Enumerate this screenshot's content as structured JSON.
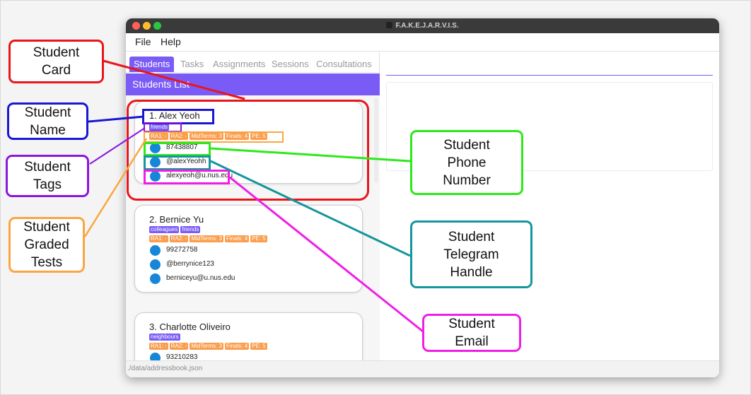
{
  "window": {
    "title": "F.A.K.E.J.A.R.V.I.S."
  },
  "menu": [
    "File",
    "Help"
  ],
  "tabs": [
    {
      "label": "Students",
      "active": true
    },
    {
      "label": "Tasks",
      "active": false
    },
    {
      "label": "Assignments",
      "active": false
    },
    {
      "label": "Sessions",
      "active": false
    },
    {
      "label": "Consultations",
      "active": false
    }
  ],
  "list": {
    "title": "Students List"
  },
  "students": [
    {
      "name": "1.  Alex Yeoh",
      "tags": [
        "friends"
      ],
      "grades": [
        "RA1: -",
        "RA2: -",
        "MidTerms: 3",
        "Finals: 4",
        "PE: 5"
      ],
      "phone": "87438807",
      "telegram": "@alexYeohh",
      "email": "alexyeoh@u.nus.edu"
    },
    {
      "name": "2.  Bernice Yu",
      "tags": [
        "colleagues",
        "friends"
      ],
      "grades": [
        "RA1: -",
        "RA2: -",
        "MidTerms: 3",
        "Finals: 4",
        "PE: 5"
      ],
      "phone": "99272758",
      "telegram": "@berrynice123",
      "email": "berniceyu@u.nus.edu"
    },
    {
      "name": "3.  Charlotte Oliveiro",
      "tags": [
        "neighbours"
      ],
      "grades": [
        "RA1: -",
        "RA2: -",
        "MidTerms: 3",
        "Finals: 4",
        "PE: 5"
      ],
      "phone": "93210283",
      "telegram": "",
      "email": ""
    }
  ],
  "status": {
    "path": "./data/addressbook.json"
  },
  "annotations": {
    "student_card": [
      "Student",
      "Card"
    ],
    "student_name": [
      "Student",
      "Name"
    ],
    "student_tags": [
      "Student",
      "Tags"
    ],
    "student_graded_tests": [
      "Student",
      "Graded",
      "Tests"
    ],
    "student_phone": [
      "Student",
      "Phone",
      "Number"
    ],
    "student_telegram": [
      "Student",
      "Telegram",
      "Handle"
    ],
    "student_email": [
      "Student",
      "Email"
    ]
  },
  "colors": {
    "accent": "#7b5bf5",
    "grade_tag": "#fa9d4c",
    "icon": "#1686d9",
    "card_callout": "#e8161c",
    "name_callout": "#1717d4",
    "tags_callout": "#8b16e0",
    "grades_callout": "#f9a640",
    "phone_callout": "#2ee81b",
    "telegram_callout": "#14969c",
    "email_callout": "#ef1ee6"
  }
}
